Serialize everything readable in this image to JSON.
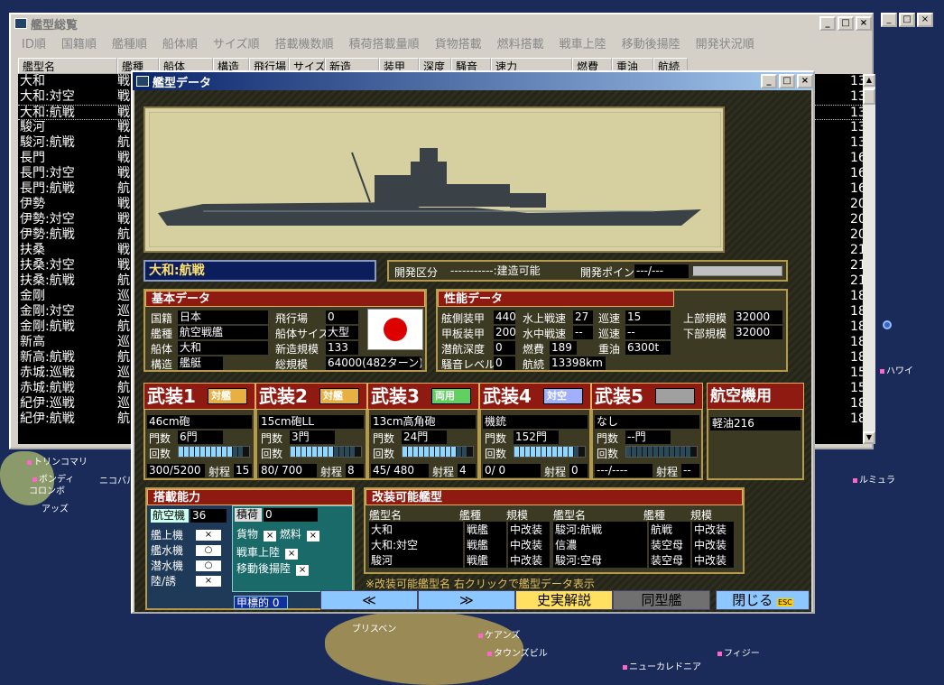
{
  "list_window": {
    "title": "艦型総覧",
    "sort_tabs": [
      "ID順",
      "国籍順",
      "艦種順",
      "船体順",
      "サイズ順",
      "搭載機数順",
      "積荷搭載量順",
      "貨物搭載",
      "燃料搭載",
      "戦車上陸",
      "移動後揚陸",
      "開発状況順"
    ],
    "columns": [
      "艦型名",
      "艦種",
      "船体",
      "構造",
      "飛行場",
      "サイズ",
      "新造",
      "装甲",
      "深度",
      "騒音",
      "速力",
      "燃費",
      "重油",
      "航続"
    ],
    "rows": [
      {
        "name": "大和",
        "type": "戦",
        "range": "13"
      },
      {
        "name": "大和:対空",
        "type": "戦",
        "range": "13"
      },
      {
        "name": "大和:航戦",
        "type": "戦",
        "range": "13"
      },
      {
        "name": "駿河",
        "type": "戦",
        "range": "13"
      },
      {
        "name": "駿河:航戦",
        "type": "航",
        "range": "13"
      },
      {
        "name": "長門",
        "type": "戦",
        "range": "16"
      },
      {
        "name": "長門:対空",
        "type": "戦",
        "range": "16"
      },
      {
        "name": "長門:航戦",
        "type": "航",
        "range": "16"
      },
      {
        "name": "伊勢",
        "type": "戦",
        "range": "20"
      },
      {
        "name": "伊勢:対空",
        "type": "戦",
        "range": "20"
      },
      {
        "name": "伊勢:航戦",
        "type": "航",
        "range": "20"
      },
      {
        "name": "扶桑",
        "type": "戦",
        "range": "21"
      },
      {
        "name": "扶桑:対空",
        "type": "戦",
        "range": "21"
      },
      {
        "name": "扶桑:航戦",
        "type": "航",
        "range": "21"
      },
      {
        "name": "金剛",
        "type": "巡",
        "range": "18"
      },
      {
        "name": "金剛:対空",
        "type": "巡",
        "range": "18"
      },
      {
        "name": "金剛:航戦",
        "type": "航",
        "range": "18"
      },
      {
        "name": "新高",
        "type": "巡",
        "range": "18"
      },
      {
        "name": "新高:航戦",
        "type": "航",
        "range": "18"
      },
      {
        "name": "赤城:巡戦",
        "type": "巡",
        "range": "15"
      },
      {
        "name": "赤城:航戦",
        "type": "航",
        "range": "15"
      },
      {
        "name": "紀伊:巡戦",
        "type": "巡",
        "range": "18"
      },
      {
        "name": "紀伊:航戦",
        "type": "航",
        "range": "18"
      }
    ]
  },
  "dialog": {
    "title": "艦型データ",
    "ship_name": "大和:航戦",
    "dev": {
      "label": "開発区分",
      "value": "-----------:建造可能",
      "pt_label": "開発ポイント",
      "pt_value": "---/---"
    },
    "basic": {
      "header": "基本データ",
      "country_l": "国籍",
      "country": "日本",
      "type_l": "艦種",
      "type": "航空戦艦",
      "hull_l": "船体",
      "hull": "大和",
      "struct_l": "構造",
      "struct": "艦艇",
      "airfield_l": "飛行場",
      "airfield": "0",
      "size_l": "船体サイズ",
      "size": "大型",
      "newscale_l": "新造規模",
      "newscale": "133",
      "total_l": "総規模",
      "total": "64000(482ターン)"
    },
    "perf": {
      "header": "性能データ",
      "side_l": "舷側装甲",
      "side": "440",
      "deck_l": "甲板装甲",
      "deck": "200",
      "depth_l": "潜航深度",
      "depth": "0",
      "noise_l": "騒音レベル",
      "noise": "0",
      "surf_l": "水上戦速",
      "surf": "27",
      "sub_l": "水中戦速",
      "sub": "--",
      "cruise1_l": "巡速",
      "cruise1": "15",
      "cruise2_l": "巡速",
      "cruise2": "--",
      "fuelc_l": "燃費",
      "fuelc": "189",
      "oil_l": "重油",
      "oil": "6300t",
      "range_l": "航続",
      "range": "13398km",
      "upper_l": "上部規模",
      "upper": "32000",
      "lower_l": "下部規模",
      "lower": "32000"
    },
    "weapons": [
      {
        "title": "武装1",
        "tag": "対艦",
        "tagcolor": "#e8b040",
        "name": "46cm砲",
        "count": "6門",
        "level": 0.8,
        "ammo": "300/5200",
        "range": "15"
      },
      {
        "title": "武装2",
        "tag": "対艦",
        "tagcolor": "#e8b040",
        "name": "15cm砲LL",
        "count": "3門",
        "level": 0.7,
        "ammo": "80/ 700",
        "range": "8"
      },
      {
        "title": "武装3",
        "tag": "両用",
        "tagcolor": "#60d060",
        "name": "13cm高角砲",
        "count": "24門",
        "level": 0.85,
        "ammo": "45/ 480",
        "range": "4"
      },
      {
        "title": "武装4",
        "tag": "対空",
        "tagcolor": "#a0b0ff",
        "name": "機銃",
        "count": "152門",
        "level": 0.9,
        "ammo": "0/ 0",
        "range": "0"
      },
      {
        "title": "武装5",
        "tag": "",
        "tagcolor": "#a0a0a0",
        "name": "なし",
        "count": "--門",
        "level": 0,
        "ammo": "---/----",
        "range": "--"
      }
    ],
    "weapon_labels": {
      "count": "門数",
      "rate": "回数",
      "range": "射程"
    },
    "aircraft": {
      "title": "航空機用",
      "fuel": "軽油216"
    },
    "carry": {
      "header": "搭載能力",
      "plane_l": "航空機",
      "plane": "36",
      "items": [
        "艦上機",
        "艦水機",
        "潜水機",
        "陸/誘"
      ],
      "marks": [
        "×",
        "○",
        "○",
        "×"
      ],
      "cargo_l": "積荷",
      "cargo": "0",
      "goods_l": "貨物",
      "fuel_l": "燃料",
      "tank_l": "戦車上陸",
      "move_l": "移動後揚陸",
      "armor_l": "甲標的",
      "armor": "0"
    },
    "mods": {
      "header": "改装可能艦型",
      "col1": "艦型名",
      "col2": "艦種",
      "col3": "規模",
      "left": [
        [
          "大和",
          "戦艦",
          "中改装"
        ],
        [
          "大和:対空",
          "戦艦",
          "中改装"
        ],
        [
          "駿河",
          "戦艦",
          "中改装"
        ]
      ],
      "right": [
        [
          "駿河:航戦",
          "航戦",
          "中改装"
        ],
        [
          "信濃",
          "装空母",
          "中改装"
        ],
        [
          "駿河:空母",
          "装空母",
          "中改装"
        ]
      ],
      "note": "※改装可能艦型名 右クリックで艦型データ表示"
    },
    "buttons": {
      "prev": "≪",
      "next": "≫",
      "history": "史実解説",
      "same": "同型艦",
      "close": "閉じる",
      "esc": "ESC"
    }
  },
  "map": {
    "places": [
      "トリンコマリ",
      "ニコバル",
      "ボンディ",
      "コロンボ",
      "アッズ",
      "ブリスベン",
      "ケアンズ",
      "タウンズビル",
      "ニューカレドニア",
      "フィジー",
      "ハワイ",
      "ルミュラ"
    ]
  }
}
